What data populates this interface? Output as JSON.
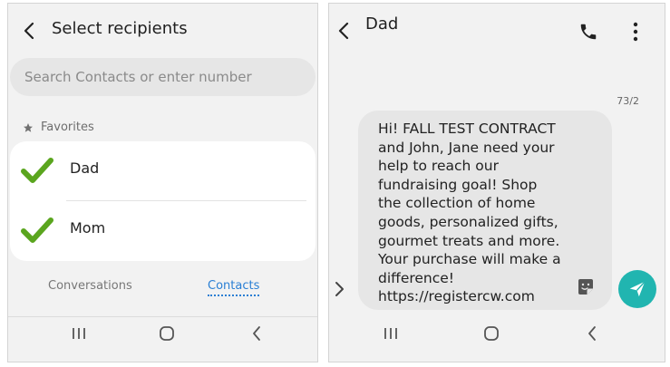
{
  "left_screen": {
    "header": {
      "title": "Select recipients",
      "back_icon": "chevron-left-icon"
    },
    "search": {
      "placeholder": "Search Contacts or enter number"
    },
    "favorites": {
      "label": "Favorites",
      "icon": "star-icon",
      "contacts": [
        {
          "name": "Dad",
          "selected": true
        },
        {
          "name": "Mom",
          "selected": true
        }
      ]
    },
    "tabs": [
      {
        "label": "Conversations",
        "active": false
      },
      {
        "label": "Contacts",
        "active": true
      }
    ],
    "colors": {
      "check": "#5aa51e",
      "active_tab": "#2a7fd4",
      "background": "#f2f2f2"
    }
  },
  "right_screen": {
    "header": {
      "title": "Dad",
      "back_icon": "chevron-left-icon",
      "call_icon": "phone-icon",
      "menu_icon": "more-vertical-icon"
    },
    "counter": "73/2",
    "message_lines": [
      "Hi! FALL TEST CONTRACT",
      "and John, Jane need your",
      "help to reach our",
      "fundraising goal! Shop",
      "the collection of home",
      "goods, personalized gifts,",
      "gourmet treats and more.",
      "Your purchase will make a",
      "difference!",
      "https://registercw.com"
    ],
    "colors": {
      "send_button": "#21b5b0",
      "bubble": "#e6e6e6"
    }
  },
  "system_nav": {
    "icons": [
      "recent-apps-icon",
      "home-icon",
      "back-icon"
    ]
  }
}
